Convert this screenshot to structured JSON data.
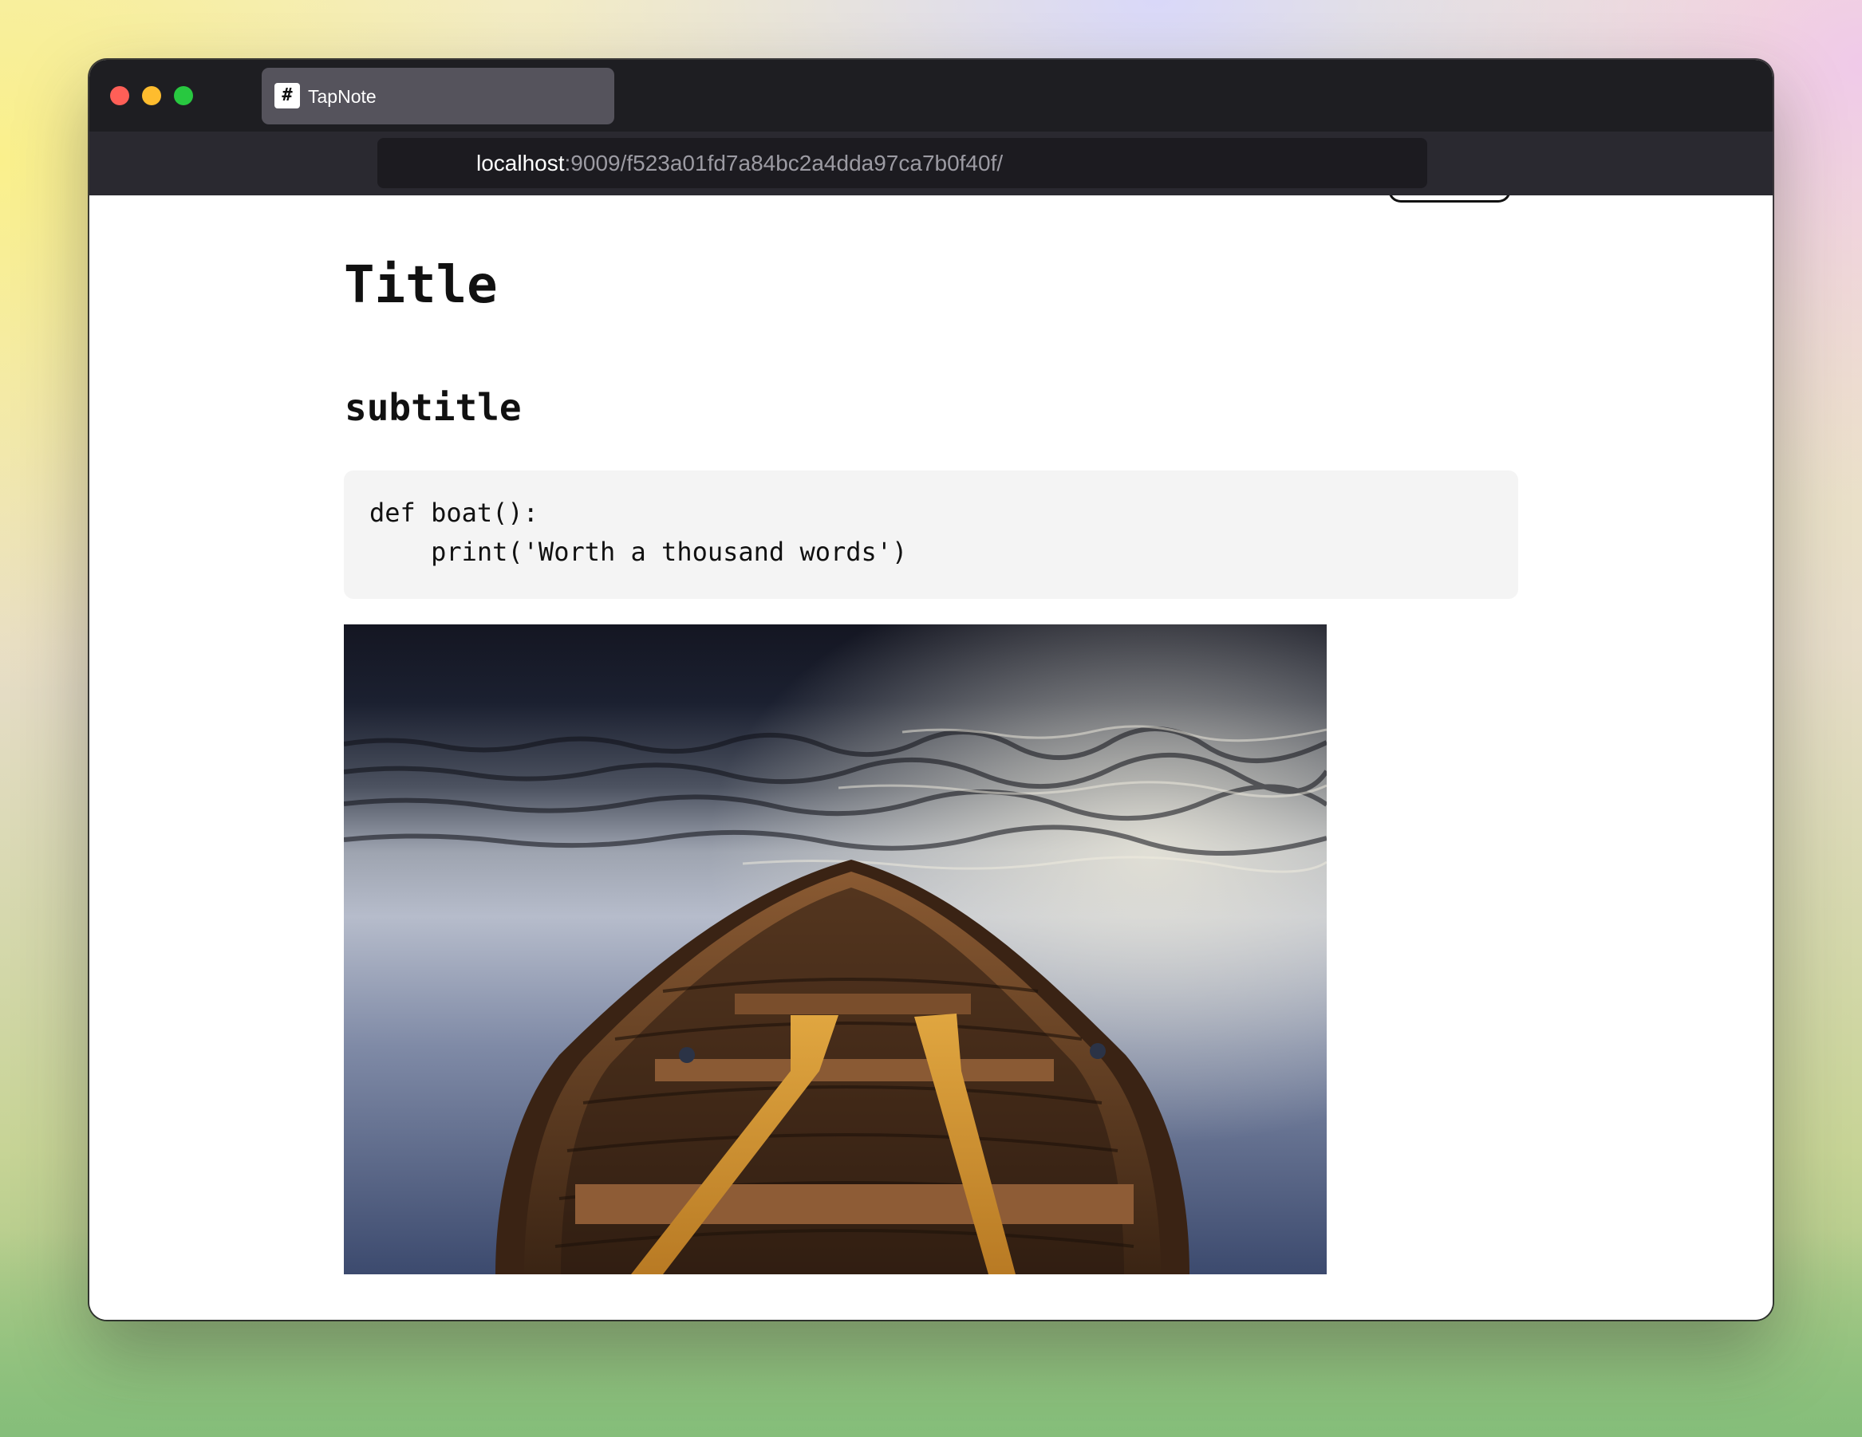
{
  "browser": {
    "tab": {
      "title": "TapNote",
      "favicon_glyph": "#"
    },
    "url": {
      "host": "localhost",
      "path": ":9009/f523a01fd7a84bc2a4dda97ca7b0f40f/"
    }
  },
  "note": {
    "title": "Title",
    "subtitle": "subtitle",
    "code_lines": [
      "def boat():",
      "    print('Worth a thousand words')"
    ]
  },
  "colors": {
    "titlebar": "#1e1e22",
    "tab_active": "#55535c",
    "url_bar": "#1c1b20",
    "code_background": "#f4f4f4",
    "traffic_close": "#ff5f57",
    "traffic_minimize": "#febc2e",
    "traffic_maximize": "#28c840"
  }
}
